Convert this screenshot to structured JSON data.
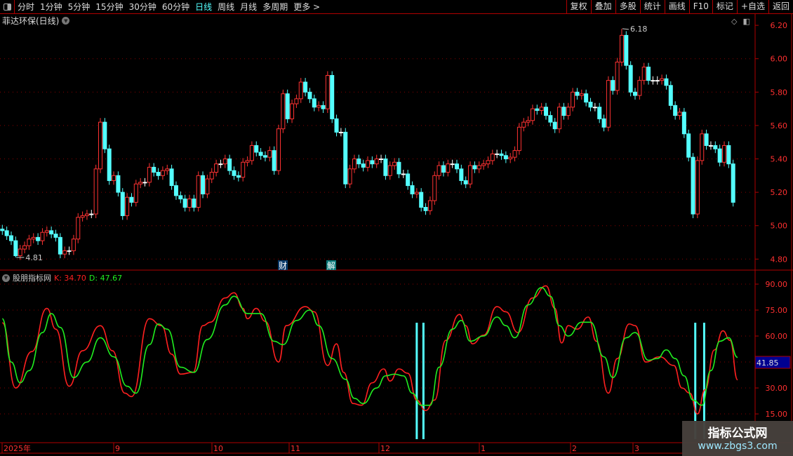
{
  "toolbar": {
    "periods": [
      "分时",
      "1分钟",
      "5分钟",
      "15分钟",
      "30分钟",
      "60分钟",
      "日线",
      "周线",
      "月线",
      "多周期",
      "更多 >"
    ],
    "active": "日线",
    "buttons": [
      "复权",
      "叠加",
      "多股",
      "统计",
      "画线",
      "F10",
      "标记",
      "+自选",
      "返回"
    ]
  },
  "stock_title": "菲达环保(日线)",
  "kdj": {
    "name": "股朋指标网",
    "k_label": "K: 34.70",
    "d_label": "D: 47.67",
    "current_marker": "41.85"
  },
  "markers": {
    "cai": "财",
    "jie": "解"
  },
  "max_label": "6.18",
  "min_label": "4.81",
  "time_axis": [
    "2025年",
    "9",
    "10",
    "11",
    "12",
    "1",
    "2",
    "3"
  ],
  "watermark": {
    "title": "指标公式网",
    "url": "www.zbgs3.com"
  },
  "colors": {
    "up": "#ff3232",
    "down": "#54ffff",
    "k": "#ff2020",
    "d": "#20ee20",
    "axis": "#b00000"
  },
  "chart_data": [
    {
      "type": "candlestick",
      "title": "菲达环保(日线)",
      "y_ticks": [
        "6.20",
        "6.00",
        "5.80",
        "5.60",
        "5.40",
        "5.20",
        "5.00",
        "4.80"
      ],
      "ylim": [
        4.8,
        6.2
      ],
      "closes": [
        4.97,
        4.94,
        4.91,
        4.82,
        4.86,
        4.88,
        4.92,
        4.93,
        4.91,
        4.96,
        4.97,
        4.95,
        4.93,
        4.83,
        4.85,
        4.85,
        4.92,
        5.05,
        5.06,
        5.07,
        5.07,
        5.34,
        5.62,
        5.46,
        5.27,
        5.3,
        5.2,
        5.06,
        5.17,
        5.14,
        5.25,
        5.26,
        5.26,
        5.35,
        5.32,
        5.3,
        5.33,
        5.34,
        5.24,
        5.18,
        5.16,
        5.11,
        5.16,
        5.11,
        5.3,
        5.19,
        5.28,
        5.32,
        5.37,
        5.37,
        5.4,
        5.33,
        5.3,
        5.29,
        5.38,
        5.39,
        5.48,
        5.44,
        5.42,
        5.41,
        5.45,
        5.33,
        5.58,
        5.79,
        5.64,
        5.73,
        5.76,
        5.86,
        5.8,
        5.76,
        5.71,
        5.72,
        5.7,
        5.9,
        5.64,
        5.56,
        5.56,
        5.25,
        5.34,
        5.4,
        5.37,
        5.35,
        5.39,
        5.37,
        5.4,
        5.4,
        5.3,
        5.36,
        5.38,
        5.31,
        5.31,
        5.24,
        5.19,
        5.2,
        5.11,
        5.09,
        5.15,
        5.3,
        5.36,
        5.32,
        5.37,
        5.37,
        5.34,
        5.27,
        5.25,
        5.36,
        5.34,
        5.36,
        5.37,
        5.39,
        5.43,
        5.43,
        5.42,
        5.4,
        5.41,
        5.45,
        5.59,
        5.62,
        5.63,
        5.7,
        5.69,
        5.71,
        5.66,
        5.62,
        5.58,
        5.71,
        5.66,
        5.71,
        5.8,
        5.78,
        5.79,
        5.74,
        5.71,
        5.71,
        5.64,
        5.59,
        5.87,
        5.81,
        5.98,
        6.14,
        5.96,
        5.8,
        5.78,
        5.87,
        5.95,
        5.87,
        5.87,
        5.87,
        5.88,
        5.84,
        5.72,
        5.66,
        5.68,
        5.55,
        5.41,
        5.07,
        5.39,
        5.55,
        5.48,
        5.48,
        5.46,
        5.38,
        5.48,
        5.37,
        5.14
      ],
      "high": 6.18,
      "low": 4.81
    },
    {
      "type": "line",
      "title": "股朋指标网",
      "y_ticks": [
        "90.00",
        "75.00",
        "60.00",
        "30.00",
        "15.00"
      ],
      "ylim": [
        10,
        95
      ],
      "series": [
        {
          "name": "K",
          "points": [
            [
              0,
              67.7
            ],
            [
              3,
              30
            ],
            [
              6.6,
              51
            ],
            [
              10,
              76
            ],
            [
              12,
              64
            ],
            [
              15,
              31
            ],
            [
              18,
              51.5
            ],
            [
              22,
              66
            ],
            [
              24.7,
              51.5
            ],
            [
              27.5,
              27
            ],
            [
              29,
              25
            ],
            [
              33,
              70
            ],
            [
              35.7,
              66
            ],
            [
              38,
              49.5
            ],
            [
              40,
              38
            ],
            [
              42.8,
              39
            ],
            [
              45,
              66
            ],
            [
              46.7,
              68
            ],
            [
              50,
              82
            ],
            [
              52,
              85
            ],
            [
              54,
              76
            ],
            [
              55,
              70
            ],
            [
              57,
              76
            ],
            [
              59,
              68.5
            ],
            [
              62,
              45
            ],
            [
              63.7,
              66
            ],
            [
              68,
              77
            ],
            [
              70,
              74
            ],
            [
              73,
              43
            ],
            [
              75,
              55.5
            ],
            [
              76.6,
              39
            ],
            [
              78.7,
              21
            ],
            [
              80.6,
              20
            ],
            [
              83,
              33
            ],
            [
              85.6,
              41
            ],
            [
              87,
              34
            ],
            [
              89,
              41
            ],
            [
              91,
              38.5
            ],
            [
              93,
              23
            ],
            [
              95,
              17
            ],
            [
              97,
              23
            ],
            [
              99.5,
              57.5
            ],
            [
              102.6,
              72.5
            ],
            [
              104,
              66
            ],
            [
              105.5,
              55.5
            ],
            [
              108,
              60.5
            ],
            [
              111,
              77
            ],
            [
              113,
              74
            ],
            [
              115.7,
              62
            ],
            [
              119,
              82
            ],
            [
              122,
              89
            ],
            [
              124,
              76
            ],
            [
              125.5,
              56
            ],
            [
              127,
              66
            ],
            [
              129,
              64
            ],
            [
              131.5,
              71
            ],
            [
              133.3,
              57
            ],
            [
              136,
              27
            ],
            [
              138,
              47
            ],
            [
              140.7,
              67
            ],
            [
              142,
              66
            ],
            [
              144.4,
              45
            ],
            [
              147.5,
              48
            ],
            [
              150.7,
              43
            ],
            [
              152.5,
              30
            ],
            [
              154.3,
              27
            ],
            [
              156,
              15
            ],
            [
              157.7,
              29
            ],
            [
              159.8,
              52
            ],
            [
              161.7,
              63
            ],
            [
              163.3,
              57.5
            ],
            [
              165,
              34.7
            ]
          ]
        },
        {
          "name": "D",
          "points": [
            [
              0,
              70
            ],
            [
              2,
              45
            ],
            [
              4,
              33
            ],
            [
              6,
              40
            ],
            [
              9,
              62
            ],
            [
              11,
              73
            ],
            [
              13,
              65
            ],
            [
              16,
              36
            ],
            [
              19,
              45
            ],
            [
              22,
              59
            ],
            [
              25,
              48
            ],
            [
              28,
              31
            ],
            [
              30,
              27
            ],
            [
              33,
              55
            ],
            [
              35,
              67
            ],
            [
              37,
              64
            ],
            [
              40,
              42
            ],
            [
              43,
              39
            ],
            [
              46,
              58
            ],
            [
              50,
              78
            ],
            [
              52,
              83
            ],
            [
              55,
              73
            ],
            [
              58,
              73
            ],
            [
              61,
              57
            ],
            [
              63,
              55
            ],
            [
              66,
              69
            ],
            [
              69,
              75
            ],
            [
              71,
              66
            ],
            [
              74,
              47
            ],
            [
              77,
              35
            ],
            [
              79,
              24
            ],
            [
              81,
              21
            ],
            [
              84,
              30
            ],
            [
              86,
              37
            ],
            [
              88,
              38
            ],
            [
              90,
              37
            ],
            [
              92,
              27
            ],
            [
              94,
              20
            ],
            [
              96,
              20
            ],
            [
              98,
              42
            ],
            [
              101,
              64
            ],
            [
              103,
              69
            ],
            [
              105,
              57
            ],
            [
              108,
              60
            ],
            [
              111,
              71
            ],
            [
              113,
              66
            ],
            [
              115,
              59
            ],
            [
              118,
              78
            ],
            [
              121,
              88
            ],
            [
              123,
              83
            ],
            [
              125,
              66
            ],
            [
              127,
              60
            ],
            [
              130,
              68
            ],
            [
              132,
              68
            ],
            [
              135,
              48
            ],
            [
              137,
              36
            ],
            [
              140,
              59
            ],
            [
              142,
              62
            ],
            [
              145,
              46
            ],
            [
              147,
              47
            ],
            [
              149,
              52
            ],
            [
              151,
              47
            ],
            [
              153,
              37
            ],
            [
              155,
              23
            ],
            [
              157,
              20
            ],
            [
              159,
              40
            ],
            [
              161,
              57
            ],
            [
              163,
              59
            ],
            [
              165,
              47.67
            ]
          ]
        }
      ],
      "signal_bars": [
        93,
        94.5,
        155.5,
        157.5
      ]
    }
  ]
}
